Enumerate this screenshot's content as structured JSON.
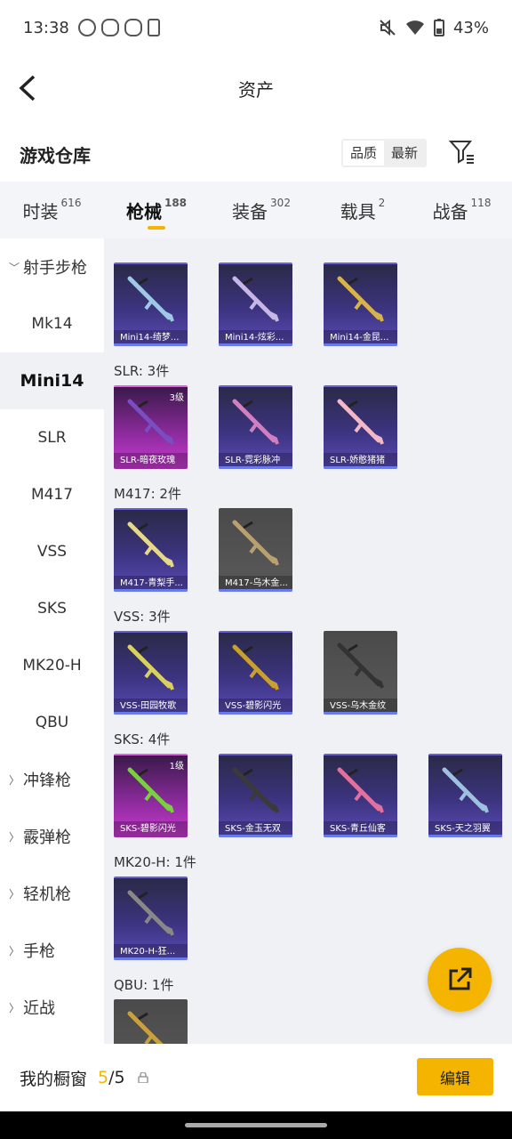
{
  "status": {
    "time": "13:38",
    "battery": "43%"
  },
  "header": {
    "title": "资产"
  },
  "warehouse": {
    "title": "游戏仓库",
    "sort_quality": "品质",
    "sort_latest": "最新"
  },
  "tabs": [
    {
      "label": "时装",
      "count": "616"
    },
    {
      "label": "枪械",
      "count": "188"
    },
    {
      "label": "装备",
      "count": "302"
    },
    {
      "label": "载具",
      "count": "2"
    },
    {
      "label": "战备",
      "count": "118"
    }
  ],
  "sidebar": [
    {
      "label": "射手步枪"
    },
    {
      "label": "Mk14"
    },
    {
      "label": "Mini14"
    },
    {
      "label": "SLR"
    },
    {
      "label": "M417"
    },
    {
      "label": "VSS"
    },
    {
      "label": "SKS"
    },
    {
      "label": "MK20-H"
    },
    {
      "label": "QBU"
    },
    {
      "label": "冲锋枪"
    },
    {
      "label": "霰弹枪"
    },
    {
      "label": "轻机枪"
    },
    {
      "label": "手枪"
    },
    {
      "label": "近战"
    }
  ],
  "sections": [
    {
      "label": "",
      "items": [
        {
          "name": "Mini14-绮梦...",
          "rarity": "purple"
        },
        {
          "name": "Mini14-炫彩...",
          "rarity": "purple"
        },
        {
          "name": "Mini14-金昆...",
          "rarity": "purple"
        }
      ]
    },
    {
      "label": "SLR: 3件",
      "items": [
        {
          "name": "SLR-暗夜玫瑰",
          "rarity": "pink",
          "level": "3级"
        },
        {
          "name": "SLR-霓彩脉冲",
          "rarity": "purple"
        },
        {
          "name": "SLR-娇憨猪猪",
          "rarity": "purple"
        }
      ]
    },
    {
      "label": "M417: 2件",
      "items": [
        {
          "name": "M417-青梨手...",
          "rarity": "purple"
        },
        {
          "name": "M417-乌木金...",
          "rarity": "gray"
        }
      ]
    },
    {
      "label": "VSS: 3件",
      "items": [
        {
          "name": "VSS-田园牧歌",
          "rarity": "purple"
        },
        {
          "name": "VSS-碧影闪光",
          "rarity": "purple"
        },
        {
          "name": "VSS-乌木金纹",
          "rarity": "gray"
        }
      ]
    },
    {
      "label": "SKS: 4件",
      "items": [
        {
          "name": "SKS-碧影闪光",
          "rarity": "pink",
          "level": "1级"
        },
        {
          "name": "SKS-金玉无双",
          "rarity": "purple"
        },
        {
          "name": "SKS-青丘仙客",
          "rarity": "purple"
        },
        {
          "name": "SKS-天之羽翼",
          "rarity": "purple"
        }
      ]
    },
    {
      "label": "MK20-H: 1件",
      "items": [
        {
          "name": "MK20-H-狂...",
          "rarity": "purple"
        }
      ]
    },
    {
      "label": "QBU: 1件",
      "items": [
        {
          "name": "",
          "rarity": "gray"
        }
      ]
    }
  ],
  "bottom": {
    "label": "我的橱窗",
    "count_current": "5",
    "count_total": "/5",
    "edit": "编辑"
  },
  "colors": {
    "accent": "#f5b400",
    "purple": "#3c3480",
    "pink": "#c83ad0"
  }
}
